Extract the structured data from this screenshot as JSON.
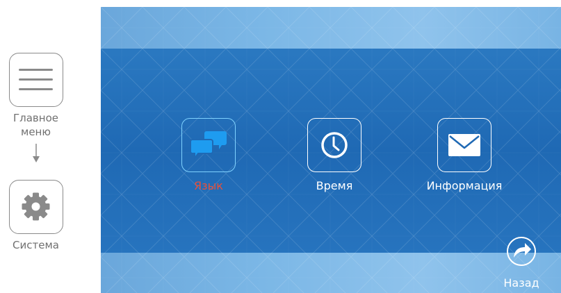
{
  "sidebar": {
    "main_menu_label": "Главное\nменю",
    "system_label": "Система",
    "main_menu_icon": "hamburger-menu-icon",
    "system_icon": "gear-icon"
  },
  "menu": {
    "items": [
      {
        "label": "Язык",
        "icon": "chat-bubbles-icon",
        "selected": true
      },
      {
        "label": "Время",
        "icon": "clock-icon",
        "selected": false
      },
      {
        "label": "Информация",
        "icon": "envelope-icon",
        "selected": false
      }
    ]
  },
  "back": {
    "label": "Назад",
    "icon": "forward-arrow-icon"
  },
  "colors": {
    "screen_blue": "#1f69b4",
    "band_light_blue": "#7bb7e6",
    "selected_label": "#e8503a",
    "selected_tile_border": "#7fd2ff",
    "selected_icon": "#1e9cf0"
  }
}
